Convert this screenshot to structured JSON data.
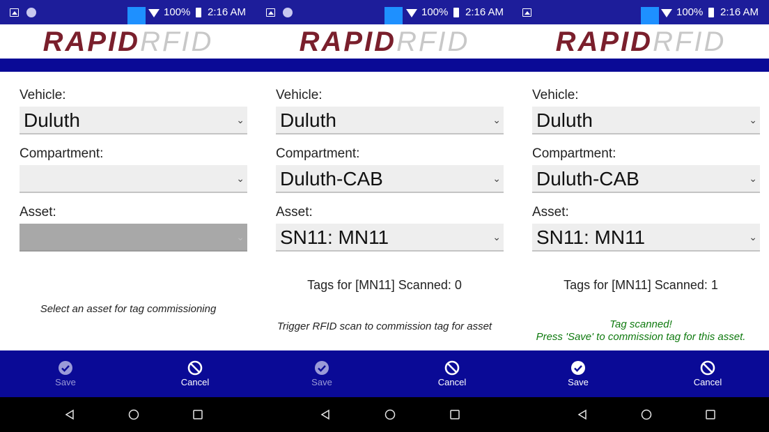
{
  "colors": {
    "status_bar": "#1d1d9a",
    "header_bar": "#0a0a96",
    "footer": "#0a0a96",
    "logo_rapid": "#7a1f2c",
    "logo_rfid": "#c8c8c8",
    "success_text": "#0f7a0f"
  },
  "screens": [
    {
      "status": {
        "battery": "100%",
        "time": "2:16 AM"
      },
      "logo": {
        "rapid": "RAPID",
        "rfid": "RFID"
      },
      "vehicle": {
        "label": "Vehicle:",
        "value": "Duluth"
      },
      "compartment": {
        "label": "Compartment:",
        "value": ""
      },
      "asset": {
        "label": "Asset:",
        "value": "",
        "disabled": true
      },
      "tags_text": "",
      "message": "Select an asset for tag commissioning",
      "message_line2": "",
      "footer": {
        "save": "Save",
        "cancel": "Cancel",
        "save_enabled": false
      },
      "nav_icons": [
        "back-icon",
        "home-icon",
        "recents-icon"
      ]
    },
    {
      "status": {
        "battery": "100%",
        "time": "2:16 AM"
      },
      "logo": {
        "rapid": "RAPID",
        "rfid": "RFID"
      },
      "vehicle": {
        "label": "Vehicle:",
        "value": "Duluth"
      },
      "compartment": {
        "label": "Compartment:",
        "value": "Duluth-CAB"
      },
      "asset": {
        "label": "Asset:",
        "value": "SN11: MN11",
        "disabled": false
      },
      "tags_text": "Tags for [MN11] Scanned: 0",
      "message": "Trigger RFID scan to commission tag for asset",
      "message_line2": "",
      "footer": {
        "save": "Save",
        "cancel": "Cancel",
        "save_enabled": false
      },
      "nav_icons": [
        "back-icon",
        "home-icon",
        "recents-icon"
      ]
    },
    {
      "status": {
        "battery": "100%",
        "time": "2:16 AM"
      },
      "logo": {
        "rapid": "RAPID",
        "rfid": "RFID"
      },
      "vehicle": {
        "label": "Vehicle:",
        "value": "Duluth"
      },
      "compartment": {
        "label": "Compartment:",
        "value": "Duluth-CAB"
      },
      "asset": {
        "label": "Asset:",
        "value": "SN11: MN11",
        "disabled": false
      },
      "tags_text": "Tags for [MN11] Scanned: 1",
      "message": "Tag scanned!",
      "message_line2": "Press 'Save' to commission tag for this asset.",
      "footer": {
        "save": "Save",
        "cancel": "Cancel",
        "save_enabled": true
      },
      "nav_icons": [
        "back-icon",
        "home-icon",
        "recents-icon"
      ]
    }
  ]
}
